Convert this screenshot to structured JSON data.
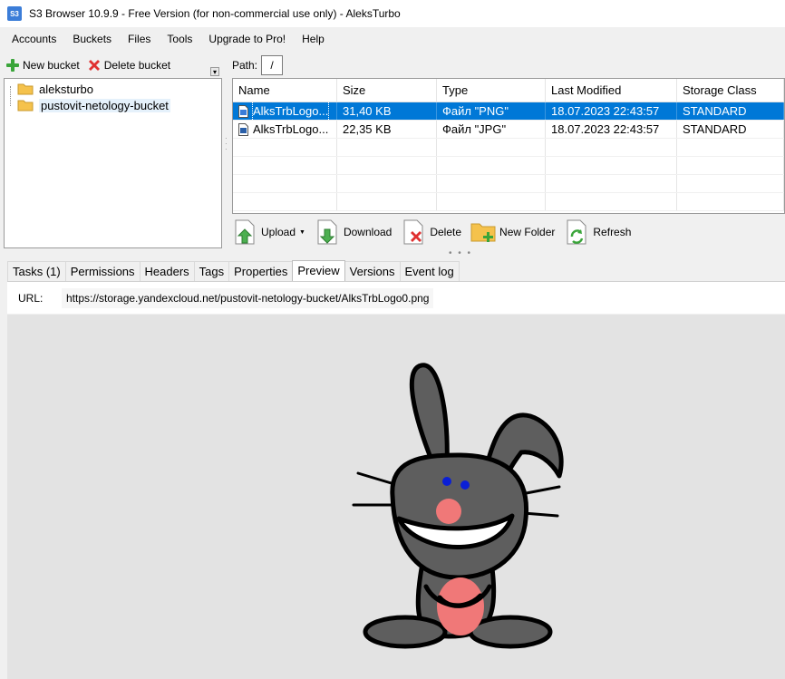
{
  "window": {
    "app_icon_text": "S3",
    "title": "S3 Browser 10.9.9 - Free Version (for non-commercial use only) - AleksTurbo"
  },
  "menu": [
    "Accounts",
    "Buckets",
    "Files",
    "Tools",
    "Upgrade to Pro!",
    "Help"
  ],
  "bucket_toolbar": {
    "new_bucket": "New bucket",
    "delete_bucket": "Delete bucket",
    "collapse_glyph": "▾"
  },
  "buckets": [
    "aleksturbo",
    "pustovit-netology-bucket"
  ],
  "selected_bucket": "pustovit-netology-bucket",
  "path": {
    "label": "Path:",
    "value": "/"
  },
  "file_list": {
    "columns": [
      "Name",
      "Size",
      "Type",
      "Last Modified",
      "Storage Class"
    ],
    "rows": [
      {
        "name": "AlksTrbLogo...",
        "size": "31,40 KB",
        "type": "Файл \"PNG\"",
        "modified": "18.07.2023 22:43:57",
        "class": "STANDARD",
        "selected": true
      },
      {
        "name": "AlksTrbLogo...",
        "size": "22,35 KB",
        "type": "Файл \"JPG\"",
        "modified": "18.07.2023 22:43:57",
        "class": "STANDARD",
        "selected": false
      }
    ]
  },
  "actions": {
    "upload": "Upload",
    "download": "Download",
    "delete": "Delete",
    "new_folder": "New Folder",
    "refresh": "Refresh",
    "splitter_glyph": "• • •"
  },
  "tabs": [
    "Tasks (1)",
    "Permissions",
    "Headers",
    "Tags",
    "Properties",
    "Preview",
    "Versions",
    "Event log"
  ],
  "active_tab": "Preview",
  "url": {
    "label": "URL:",
    "value": "https://storage.yandexcloud.net/pustovit-netology-bucket/AlksTrbLogo0.png"
  },
  "colors": {
    "selection": "#0078d7",
    "preview_background": "#e3e3e3",
    "bunny_fur": "#5e5e5e",
    "bunny_pink": "#f07878"
  },
  "icons": {
    "new_bucket": "green-plus-icon",
    "delete_bucket": "red-x-icon",
    "bucket": "folder-icon",
    "file": "image-file-icon",
    "upload": "upload-icon",
    "download": "download-icon",
    "delete": "delete-icon",
    "new_folder": "new-folder-icon",
    "refresh": "refresh-icon"
  }
}
